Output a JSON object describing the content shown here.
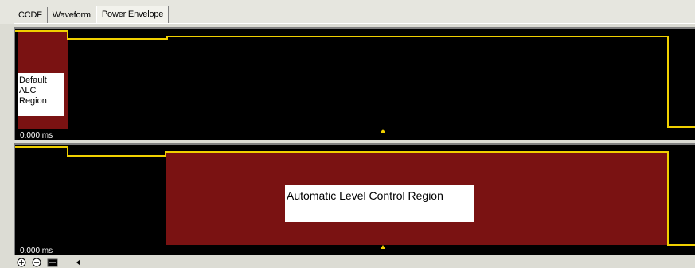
{
  "tabs": [
    {
      "label": "CCDF",
      "active": false
    },
    {
      "label": "Waveform",
      "active": false
    },
    {
      "label": "Power Envelope",
      "active": true
    }
  ],
  "top_plot": {
    "time_label": "0.000 ms",
    "region_label": "Default ALC Region",
    "region_color": "#7a1212",
    "trace_color": "#f0d000"
  },
  "bottom_plot": {
    "time_label": "0.000 ms",
    "region_label": "Automatic Level Control Region",
    "region_color": "#7a1212",
    "trace_color": "#f0d000"
  },
  "toolbar": {
    "icons": [
      "zoom-in-icon",
      "zoom-out-icon",
      "fit-icon",
      "scroll-left-icon"
    ]
  }
}
